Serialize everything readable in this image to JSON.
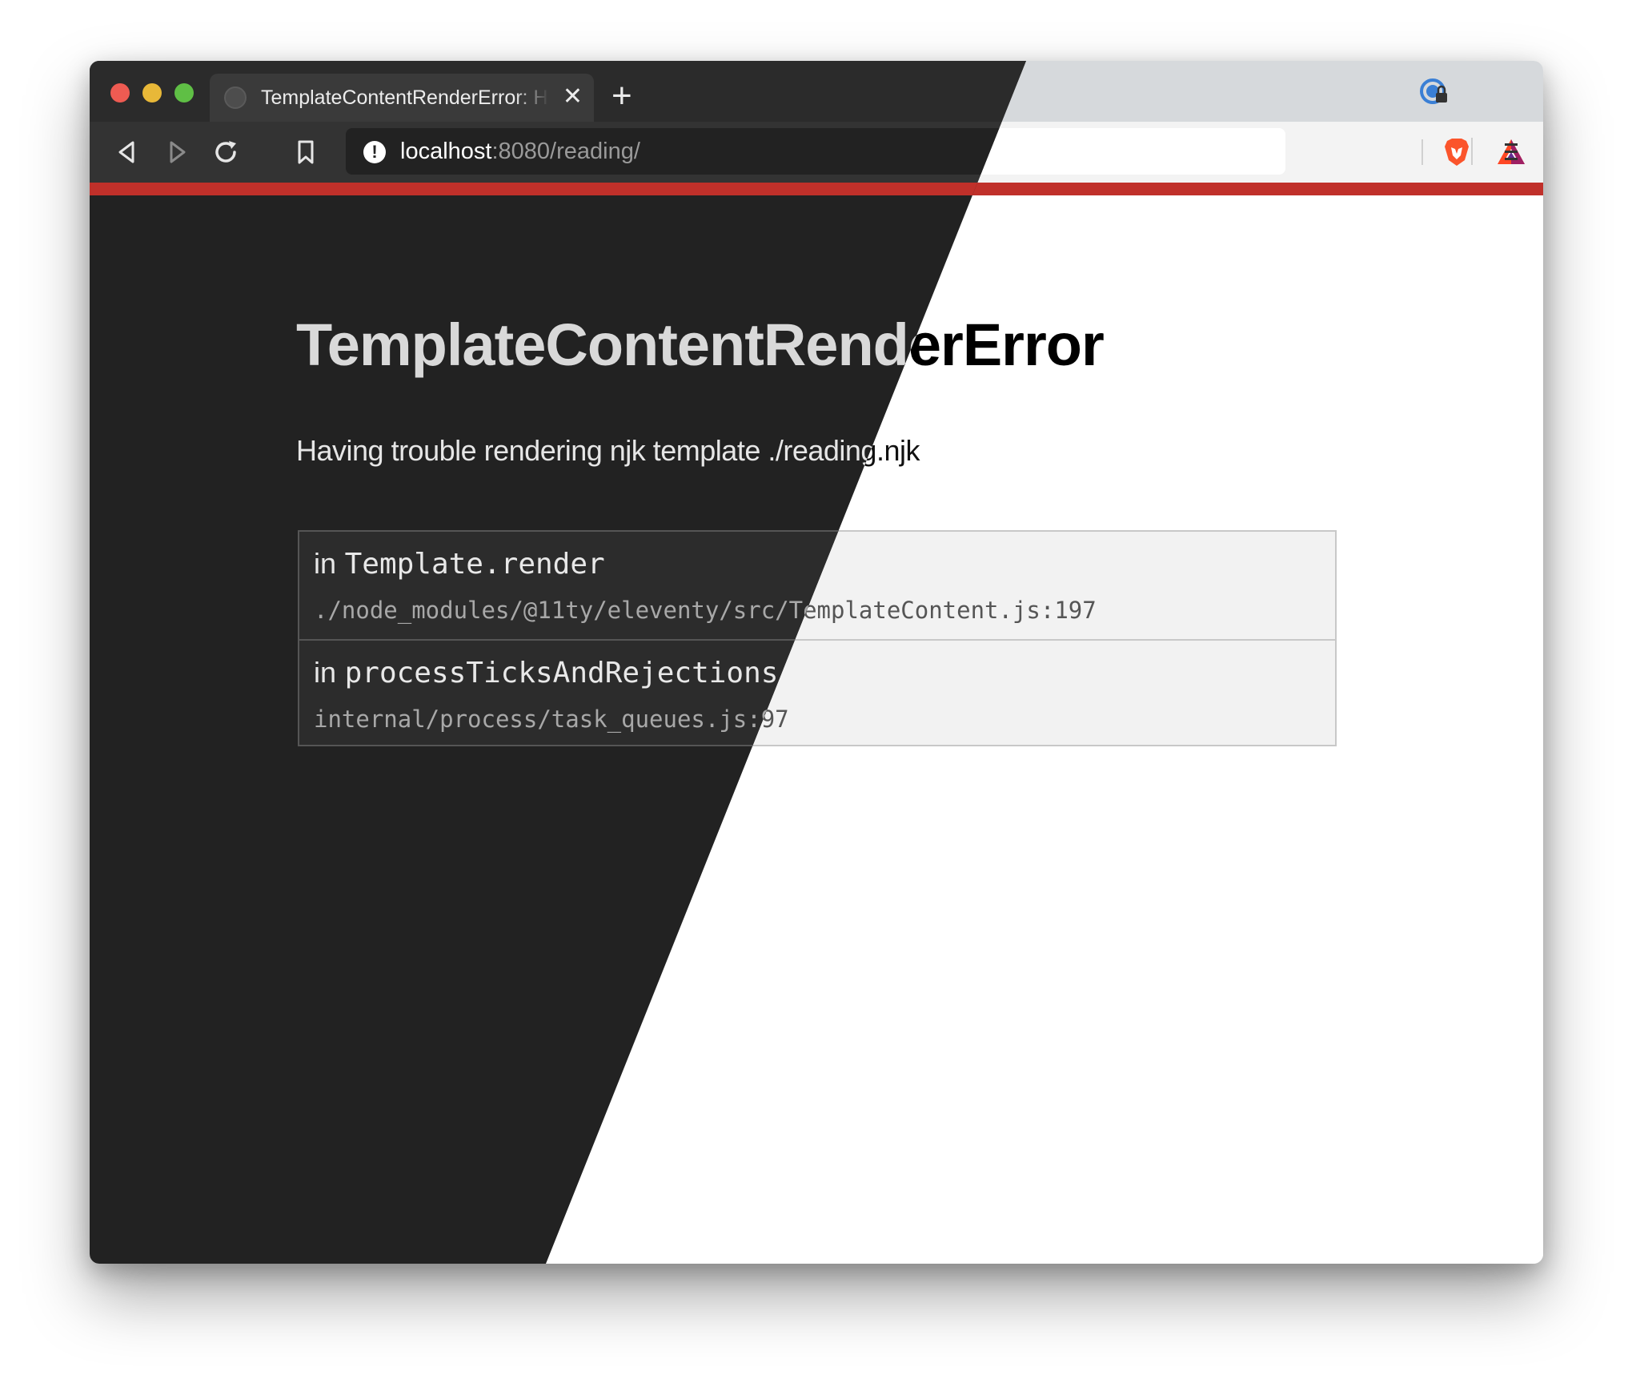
{
  "browser": {
    "tab_title": "TemplateContentRenderError: Having trouble rendering njk template ./reading.njk",
    "tab_close": "✕",
    "new_tab": "+",
    "address_host": "localhost",
    "address_rest": ":8080/reading/",
    "site_alert_glyph": "!"
  },
  "icons": {
    "back": "back-arrow-icon",
    "forward": "forward-arrow-icon",
    "reload": "reload-icon",
    "bookmark": "bookmark-icon",
    "shields": "brave-lion-icon",
    "rewards": "bat-triangle-icon",
    "password": "password-manager-icon",
    "menu": "hamburger-menu-icon"
  },
  "page": {
    "title": "TemplateContentRenderError",
    "message": "Having trouble rendering njk template ./reading.njk",
    "stack": [
      {
        "prefix": "in",
        "fn": "Template.render",
        "path": "./node_modules/@11ty/eleventy/src/TemplateContent.js:197"
      },
      {
        "prefix": "in",
        "fn": "processTicksAndRejections",
        "path": "internal/process/task_queues.js:97"
      }
    ]
  },
  "colors": {
    "dark_bg": "#222222",
    "light_bg": "#ffffff",
    "accent_bar": "#c0302a"
  }
}
